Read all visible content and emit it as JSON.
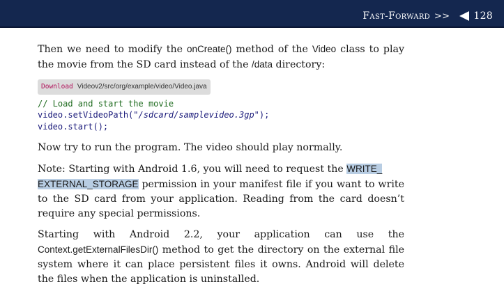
{
  "header": {
    "section_title": "Fast-Forward",
    "arrows": ">>",
    "page_number": "128"
  },
  "p1": {
    "text_a": "Then we need to modify the ",
    "method": "onCreate()",
    "text_b": " method of the ",
    "class_name": "Video",
    "text_c": " class to play the movie from the SD card instead of the ",
    "dir": "/data",
    "text_d": " directory:"
  },
  "download": {
    "label": "Download",
    "path": "Videov2/src/org/example/video/Video.java"
  },
  "code": {
    "comment": "// Load and start the movie",
    "line2_a": "video.setVideoPath(\"",
    "line2_str": "/sdcard/samplevideo.3gp",
    "line2_b": "\");",
    "line3": "video.start();"
  },
  "p2": "Now try to run the program. The video should play normally.",
  "p3": {
    "text_a": "Note: Starting with Android 1.6, you will need to request the ",
    "permission_1": "WRITE_",
    "permission_2": "EXTERNAL_STORAGE",
    "text_b": " permission in your manifest file if you want to write to the SD card from your application. Reading from the card doesn’t require any special permissions."
  },
  "p4": {
    "text_a": "Starting with Android 2.2, your application can use the ",
    "method": "Context.getExternalFilesDir()",
    "text_b": " method to get the directory on the external file system where it can place persistent files it owns. Android will delete the files when the application is uninstalled."
  },
  "colors": {
    "header_bg": "#14274f",
    "highlight": "#b8cde3",
    "download_link": "#b0115a"
  }
}
